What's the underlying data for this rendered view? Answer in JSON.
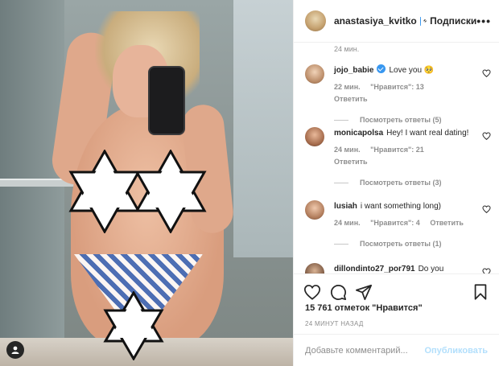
{
  "post": {
    "author": {
      "username": "anastasiya_kvitko",
      "verified": true,
      "separator": "•",
      "follow_label": "Подписки",
      "more_icon": "more-horizontal-icon"
    },
    "caption_time": "24 мин.",
    "comments": [
      {
        "username": "jojo_babie",
        "verified": true,
        "text": "Love you 🥺",
        "time": "22 мин.",
        "likes": "\"Нравится\": 13",
        "reply_label": "Ответить",
        "view_replies": "Посмотреть ответы (5)"
      },
      {
        "username": "monicapolsa",
        "verified": false,
        "text": "Hey! I want real dating!",
        "time": "24 мин.",
        "likes": "\"Нравится\": 21",
        "reply_label": "Ответить",
        "view_replies": "Посмотреть ответы (3)"
      },
      {
        "username": "lusiah",
        "verified": false,
        "text": "i want something long)",
        "time": "24 мин.",
        "likes": "\"Нравится\": 4",
        "reply_label": "Ответить",
        "view_replies": "Посмотреть ответы (1)"
      },
      {
        "username": "dillondinto27_por791",
        "verified": false,
        "text": "Do you",
        "time": "",
        "likes": "",
        "reply_label": "",
        "view_replies": ""
      }
    ],
    "likes_count": "15 761 отметок \"Нравится\"",
    "posted_time": "24 МИНУТ НАЗАД",
    "comment_input": {
      "placeholder": "Добавьте комментарий...",
      "value": ""
    },
    "publish_label": "Опубликовать",
    "icons": {
      "like": "heart-icon",
      "comment": "comment-icon",
      "share": "share-icon",
      "save": "bookmark-icon",
      "user_tag": "user-tag-icon"
    },
    "colors": {
      "verified": "#3897f0",
      "publish_disabled": "#b2dffc",
      "secondary_text": "#8e8e8e"
    }
  }
}
